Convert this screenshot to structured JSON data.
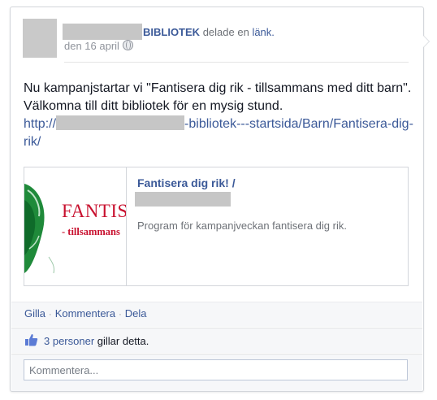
{
  "post": {
    "author_suffix": "BIBLIOTEK",
    "action_text": "delade en",
    "action_link": "länk.",
    "date": "den 16 april",
    "text_line": "Nu kampanjstartar vi \"Fantisera dig rik - tillsammans med ditt barn\". Välkomna till ditt bibliotek för en mysig stund.",
    "url_prefix": "http://",
    "url_suffix": "-bibliotek---startsida/Barn/Fantisera-dig-rik/"
  },
  "share": {
    "thumb_title": "FANTISE",
    "thumb_subtitle": "- tillsammans",
    "title": "Fantisera dig rik! /",
    "description": "Program för kampanjveckan fantisera dig rik."
  },
  "actions": {
    "like": "Gilla",
    "comment": "Kommentera",
    "share": "Dela",
    "separator": "·"
  },
  "likes": {
    "count_text": "3 personer",
    "suffix": " gillar detta."
  },
  "comment": {
    "placeholder": "Kommentera..."
  },
  "colors": {
    "link": "#3b5998",
    "thumb_red": "#c8102e",
    "thumb_green": "#1f8a3a"
  },
  "icons": [
    "globe-icon",
    "thumbs-up-icon"
  ]
}
